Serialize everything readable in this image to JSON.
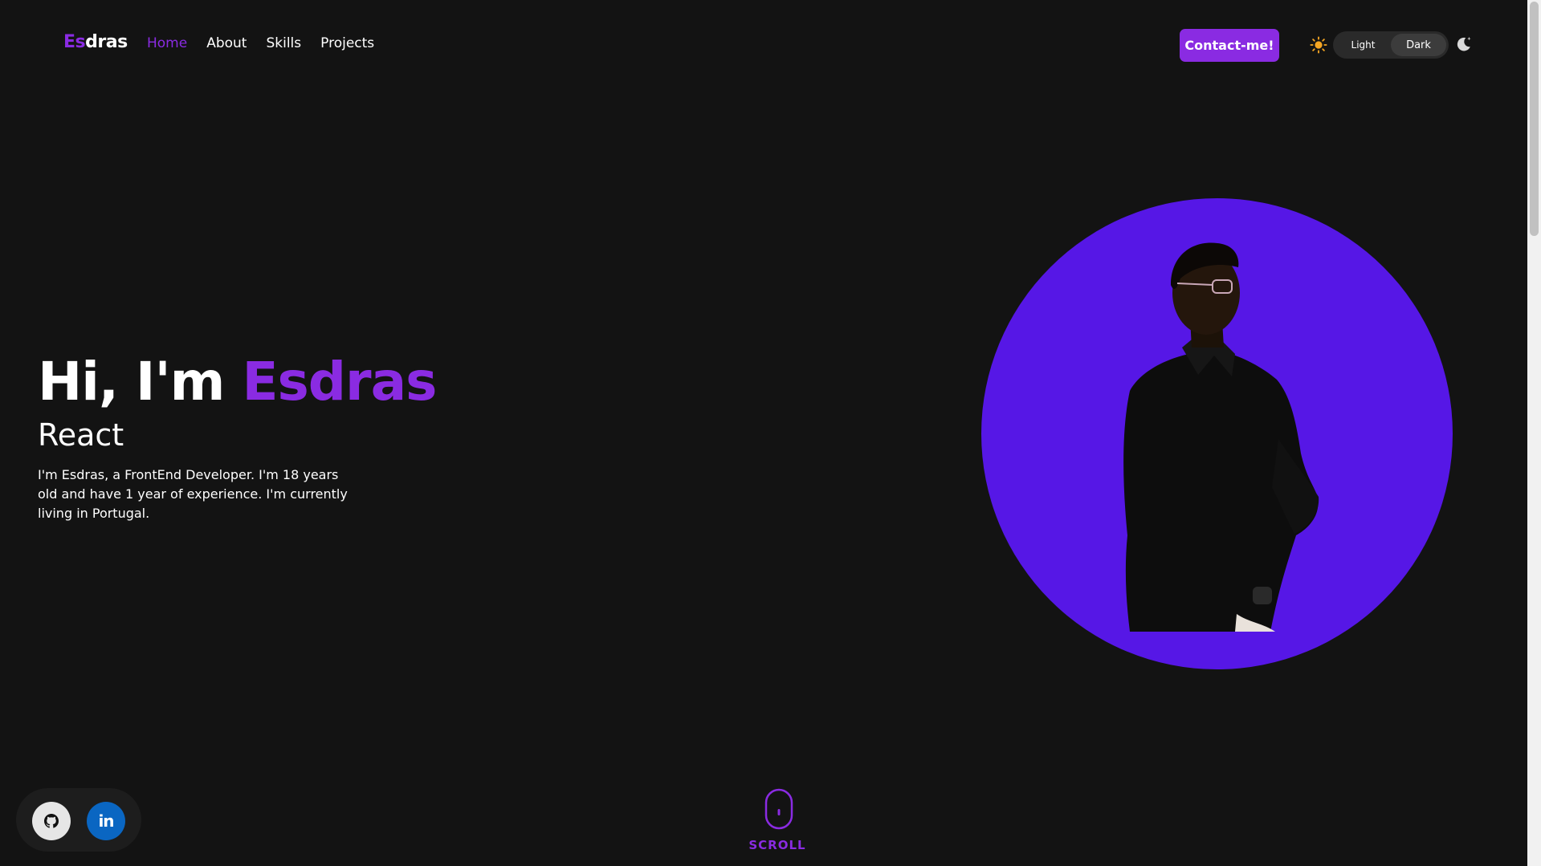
{
  "header": {
    "logo": {
      "accent": "Es",
      "rest": "dras"
    },
    "nav": [
      {
        "label": "Home",
        "active": true
      },
      {
        "label": "About",
        "active": false
      },
      {
        "label": "Skills",
        "active": false
      },
      {
        "label": "Projects",
        "active": false
      }
    ],
    "contact_label": "Contact-me!",
    "theme": {
      "light_label": "Light",
      "dark_label": "Dark",
      "selected": "Dark",
      "sun_icon": "sun-icon",
      "moon_icon": "moon-icon"
    }
  },
  "hero": {
    "greeting": "Hi, I'm",
    "name": "Esdras",
    "role": "React",
    "bio": "I'm Esdras, a FrontEnd Developer. I'm 18 years old and have 1 year of experience. I'm currently living in Portugal."
  },
  "social": {
    "github_icon": "github-icon",
    "linkedin_label": "in"
  },
  "scroll": {
    "label": "SCROLL",
    "icon": "mouse-icon"
  },
  "colors": {
    "accent": "#8a2be2",
    "portrait_bg": "#5617e6",
    "background": "#131313",
    "linkedin": "#0a66c2"
  }
}
